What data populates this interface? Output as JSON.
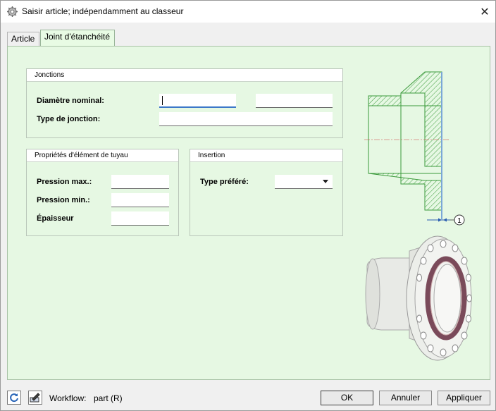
{
  "window": {
    "title": "Saisir article; indépendamment au classeur",
    "icon": "gear-icon"
  },
  "tabs": [
    {
      "label": "Article"
    },
    {
      "label": "Joint d'étanchéité"
    }
  ],
  "groups": {
    "jonctions": {
      "title": "Jonctions",
      "nominal_label": "Diamètre nominal:",
      "nominal_value_1": "",
      "nominal_value_2": "",
      "type_label": "Type de jonction:",
      "type_value": ""
    },
    "proprietes": {
      "title": "Propriétés d'élément de tuyau",
      "pmax_label": "Pression max.:",
      "pmin_label": "Pression min.:",
      "thickness_label": "Épaisseur",
      "pmax_value": "",
      "pmin_value": "",
      "thickness_value": ""
    },
    "insertion": {
      "title": "Insertion",
      "preferred_label": "Type préféré:",
      "preferred_value": ""
    }
  },
  "drawing": {
    "callout": "1"
  },
  "footer": {
    "workflow_label": "Workflow:",
    "workflow_value": "part (R)",
    "ok": "OK",
    "cancel": "Annuler",
    "apply": "Appliquer"
  },
  "colors": {
    "panel_bg": "#e6f8e3",
    "hatch": "#3b9a3b",
    "gasket": "#7a4a5a",
    "focus": "#3c78c8"
  }
}
